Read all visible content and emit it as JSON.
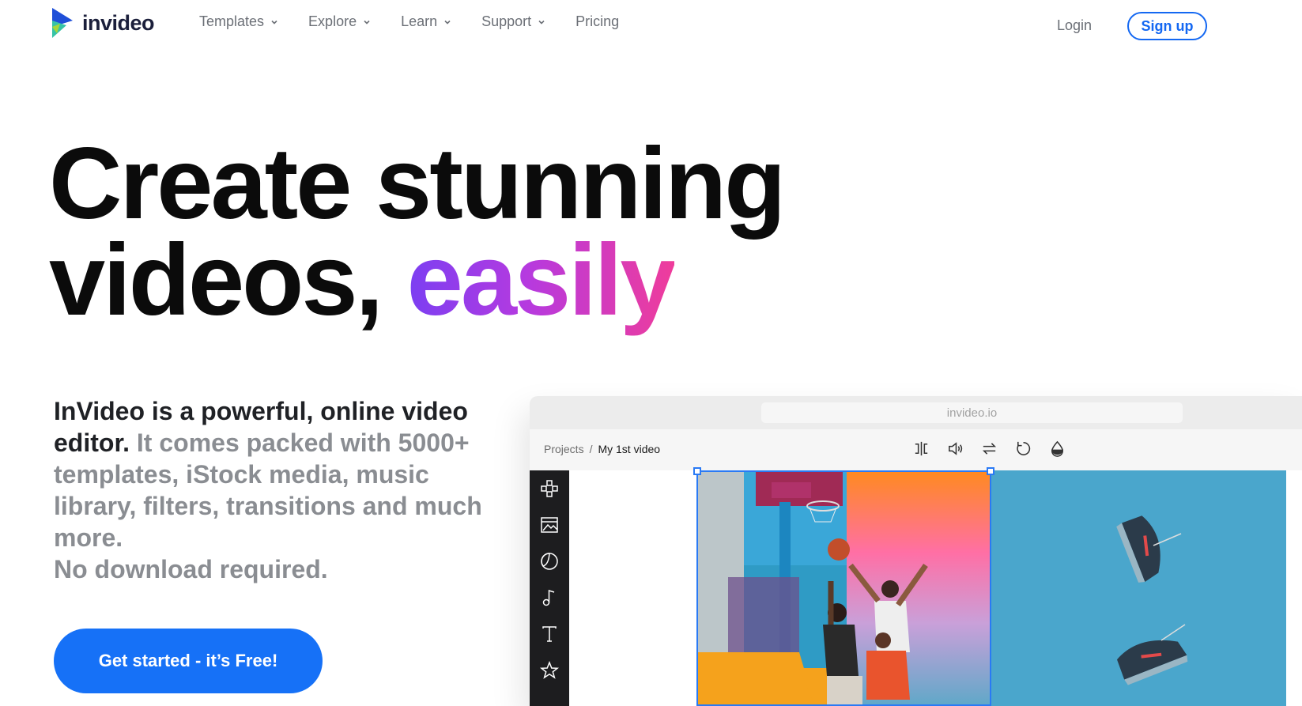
{
  "header": {
    "logo_text": "invideo",
    "nav": [
      {
        "label": "Templates",
        "has_dropdown": true
      },
      {
        "label": "Explore",
        "has_dropdown": true
      },
      {
        "label": "Learn",
        "has_dropdown": true
      },
      {
        "label": "Support",
        "has_dropdown": true
      },
      {
        "label": "Pricing",
        "has_dropdown": false
      }
    ],
    "login_label": "Login",
    "signup_label": "Sign up"
  },
  "hero": {
    "title_line1": "Create stunning",
    "title_line2_plain": "videos,",
    "title_line2_accent": "easily",
    "description_strong": "InVideo is a powerful, online video editor.",
    "description_rest": "It comes packed with 5000+ templates, iStock media, music library, filters, transitions and much more.",
    "description_tail": "No download required.",
    "cta_label": "Get started - it’s Free!"
  },
  "mockup": {
    "url": "invideo.io",
    "breadcrumb": {
      "root": "Projects",
      "separator": "/",
      "current": "My 1st video"
    },
    "toolbar_icons": [
      "split-icon",
      "volume-icon",
      "swap-icon",
      "rotate-icon",
      "opacity-drop-icon"
    ],
    "sidebar_icons": [
      "layout-grid-icon",
      "media-image-icon",
      "sticker-icon",
      "music-note-icon",
      "text-icon",
      "star-icon"
    ]
  },
  "colors": {
    "brand_blue": "#1671f7",
    "accent_gradient_start": "#7b3ff2",
    "accent_gradient_end": "#ef3c9b",
    "text_dark": "#0b0b0b",
    "text_muted": "#8a8d92"
  }
}
